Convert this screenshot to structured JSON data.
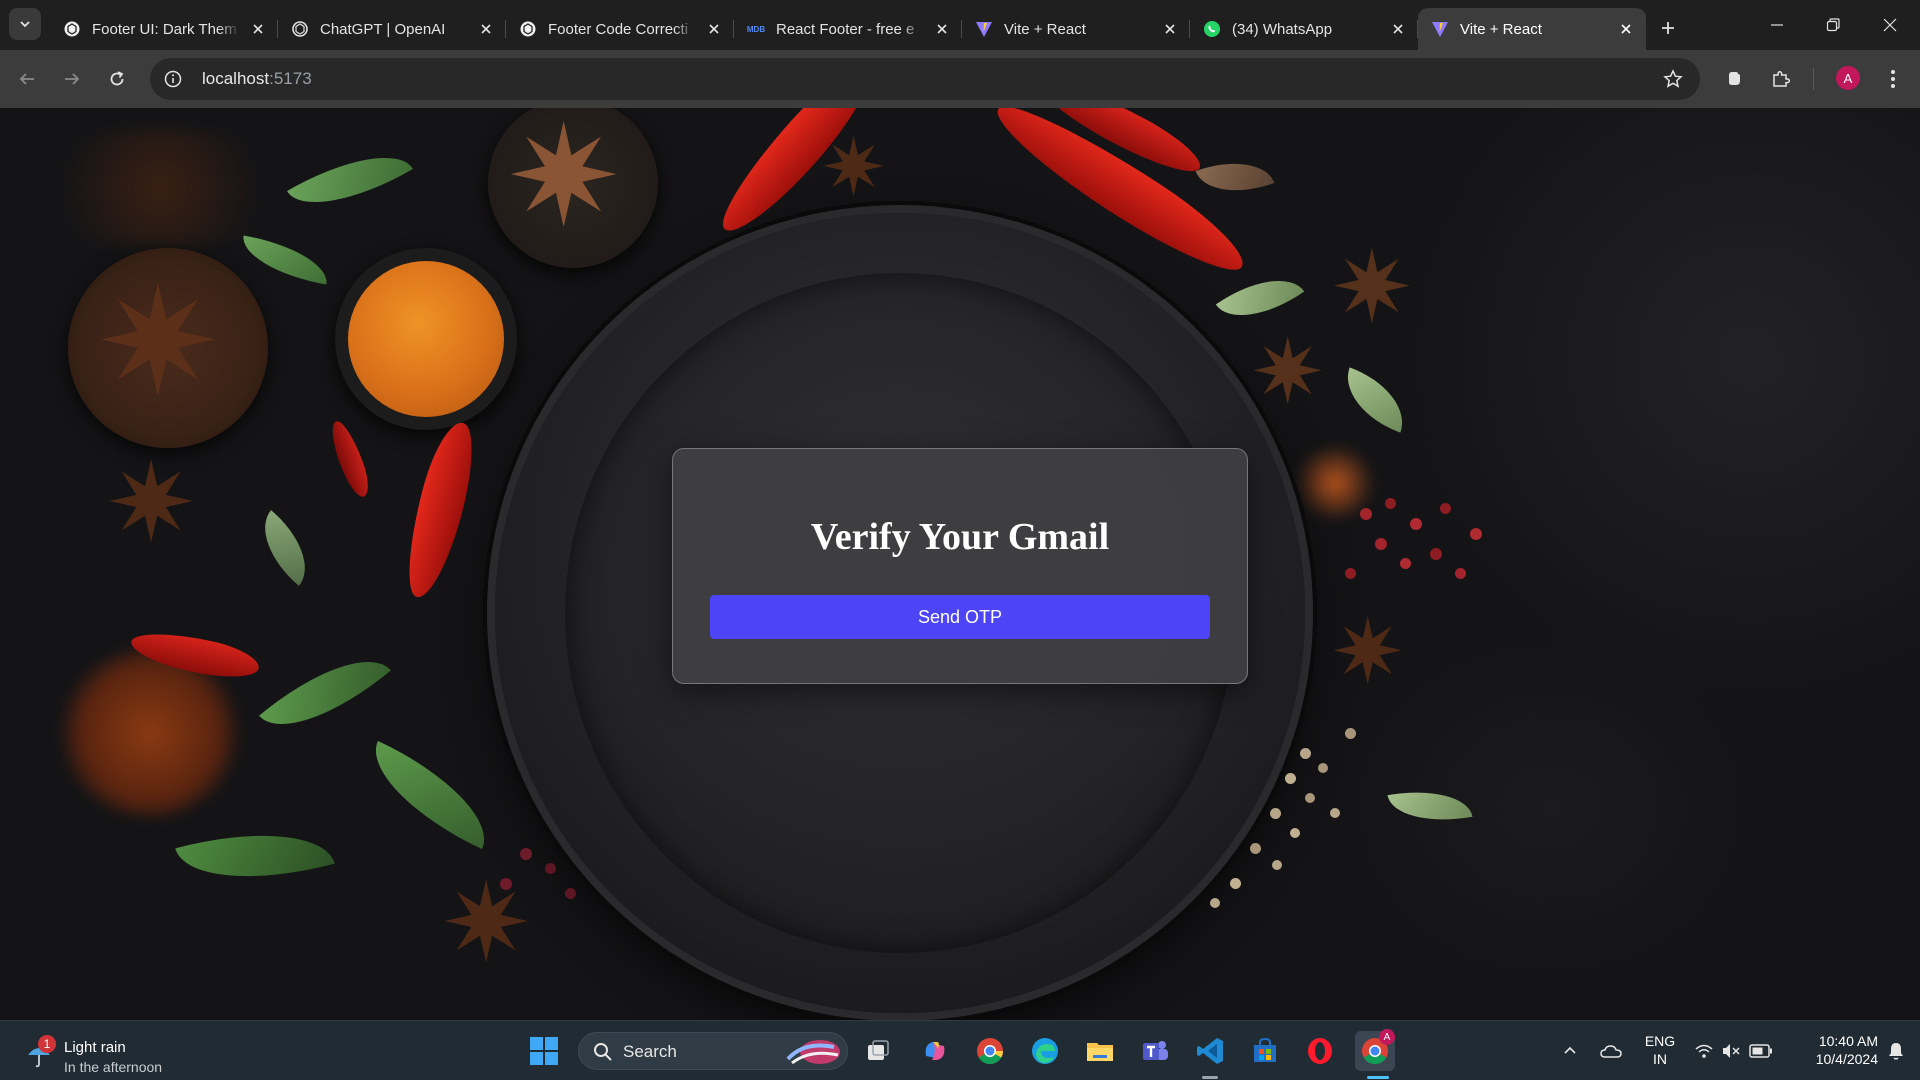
{
  "browser": {
    "tabs": [
      {
        "title": "Footer UI: Dark Them",
        "icon": "openai-icon",
        "active": false
      },
      {
        "title": "ChatGPT | OpenAI",
        "icon": "openai-icon",
        "active": false
      },
      {
        "title": "Footer Code Correcti",
        "icon": "openai-icon",
        "active": false
      },
      {
        "title": "React Footer - free e",
        "icon": "mdb-icon",
        "favicon_text": "MDB",
        "active": false
      },
      {
        "title": "Vite + React",
        "icon": "vite-icon",
        "active": false
      },
      {
        "title": "(34) WhatsApp",
        "icon": "whatsapp-icon",
        "active": false
      },
      {
        "title": "Vite + React",
        "icon": "vite-icon",
        "active": true
      }
    ],
    "url_host": "localhost",
    "url_port": ":5173",
    "profile_initial": "A"
  },
  "page": {
    "heading": "Verify Your Gmail",
    "send_otp_label": "Send OTP",
    "accent_color": "#4d44f5"
  },
  "taskbar": {
    "weather": {
      "badge": "1",
      "condition": "Light rain",
      "detail": "In the afternoon"
    },
    "search_label": "Search",
    "language": {
      "line1": "ENG",
      "line2": "IN"
    },
    "clock": {
      "time": "10:40 AM",
      "date": "10/4/2024"
    },
    "chrome_badge": "A"
  }
}
